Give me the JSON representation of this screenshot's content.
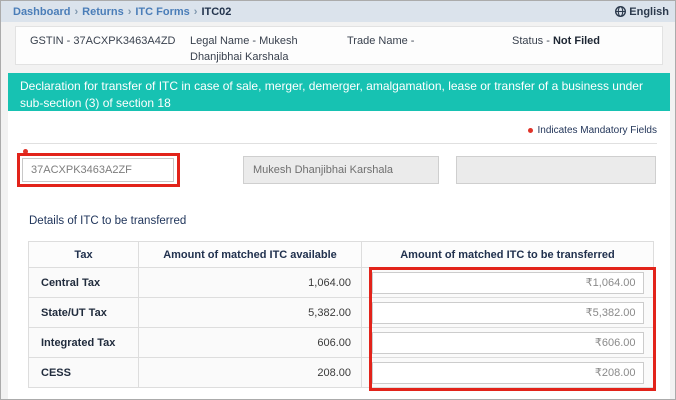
{
  "breadcrumb": {
    "dashboard": "Dashboard",
    "returns": "Returns",
    "itc_forms": "ITC Forms",
    "current": "ITC02",
    "separator": "›"
  },
  "topbar": {
    "language": "English"
  },
  "taxpayer_header": {
    "gstin": "GSTIN - 37ACXPK3463A4ZD",
    "legal_name": "Legal Name - Mukesh Dhanjibhai Karshala",
    "trade_name": "Trade Name -",
    "status_label": "Status - ",
    "status_value": "Not Filed"
  },
  "banner": {
    "title": "Declaration for transfer of ITC in case of sale, merger, demerger, amalgamation, lease or transfer of a business under sub-section (3) of section 18"
  },
  "notes": {
    "mandatory": "Indicates Mandatory Fields"
  },
  "form": {
    "gstin_value": "37ACXPK3463A2ZF",
    "legal_name_value": "Mukesh Dhanjibhai Karshala",
    "third_field_value": ""
  },
  "section": {
    "title": "Details of ITC to be transferred"
  },
  "table": {
    "headers": [
      "Tax",
      "Amount of matched ITC available",
      "Amount of matched ITC to be transferred"
    ],
    "rows": [
      {
        "tax": "Central Tax",
        "available": "1,064.00",
        "transfer": "₹1,064.00"
      },
      {
        "tax": "State/UT Tax",
        "available": "5,382.00",
        "transfer": "₹5,382.00"
      },
      {
        "tax": "Integrated Tax",
        "available": "606.00",
        "transfer": "₹606.00"
      },
      {
        "tax": "CESS",
        "available": "208.00",
        "transfer": "₹208.00"
      }
    ]
  },
  "colors": {
    "accent_teal": "#17c2b2",
    "annotation_red": "#e2231a",
    "link_blue": "#4a7db8",
    "breadcrumb_bg": "#dbe3ec"
  }
}
